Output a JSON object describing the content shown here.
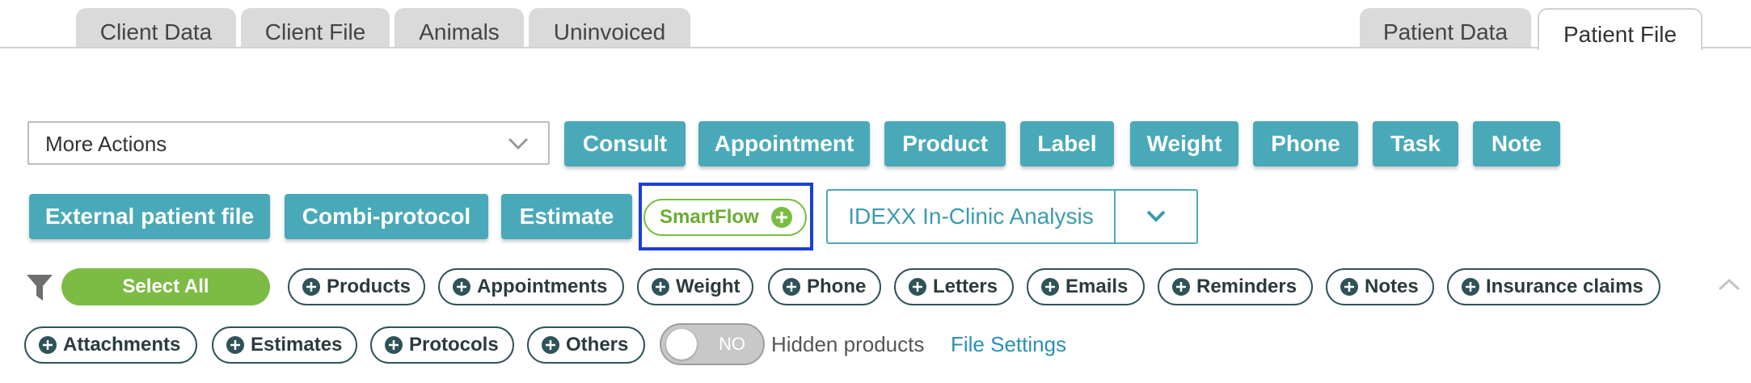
{
  "tabs_left": [
    {
      "label": "Client Data"
    },
    {
      "label": "Client File"
    },
    {
      "label": "Animals"
    },
    {
      "label": "Uninvoiced"
    }
  ],
  "tabs_right": [
    {
      "label": "Patient Data",
      "active": false
    },
    {
      "label": "Patient File",
      "active": true
    }
  ],
  "more_actions": {
    "selected": "More Actions",
    "icon": "chevron-down-icon"
  },
  "action_buttons_row1": [
    "Consult",
    "Appointment",
    "Product",
    "Label",
    "Weight",
    "Phone",
    "Task",
    "Note"
  ],
  "action_buttons_row2": [
    "External patient file",
    "Combi-protocol",
    "Estimate"
  ],
  "smartflow": {
    "label": "SmartFlow",
    "icon": "plus-circle-icon",
    "highlighted": true
  },
  "idexx": {
    "label": "IDEXX In-Clinic Analysis",
    "icon": "chevron-down-icon"
  },
  "filters": {
    "funnel_icon": "filter-icon",
    "select_all": "Select All",
    "pills": [
      "Products",
      "Appointments",
      "Weight",
      "Phone",
      "Letters",
      "Emails",
      "Reminders",
      "Notes",
      "Insurance claims",
      "Attachments",
      "Estimates",
      "Protocols",
      "Others"
    ]
  },
  "hidden_products": {
    "toggle_text": "NO",
    "label": "Hidden products"
  },
  "file_settings": "File Settings",
  "colors": {
    "teal": "#4aa9b9",
    "green": "#7bbd42",
    "highlight": "#1a3fd6",
    "pill_border": "#2e5358",
    "link": "#2d8fb4"
  }
}
